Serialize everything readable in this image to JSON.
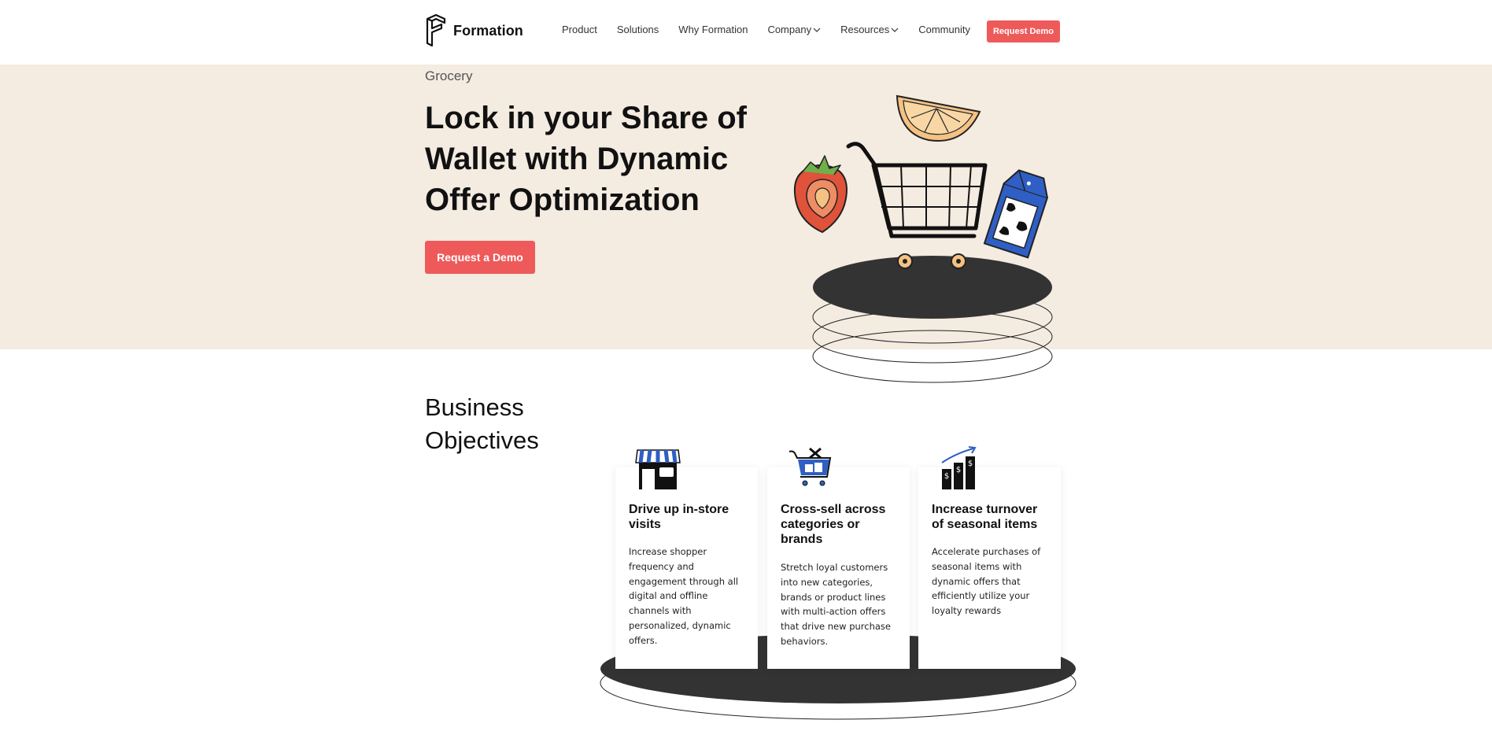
{
  "header": {
    "brand": "Formation",
    "nav": [
      {
        "label": "Product",
        "dropdown": false
      },
      {
        "label": "Solutions",
        "dropdown": false
      },
      {
        "label": "Why Formation",
        "dropdown": false
      },
      {
        "label": "Company",
        "dropdown": true
      },
      {
        "label": "Resources",
        "dropdown": true
      },
      {
        "label": "Community",
        "dropdown": false
      }
    ],
    "cta": "Request Demo"
  },
  "hero": {
    "eyebrow": "Grocery",
    "title": "Lock in your Share of Wallet with Dynamic Offer Optimization",
    "cta": "Request a Demo"
  },
  "objectives": {
    "title": "Business Objectives",
    "cards": [
      {
        "icon": "storefront-icon",
        "heading": "Drive up in-store visits",
        "body": "Increase shopper frequency and engagement through all digital and offline channels with personalized, dynamic offers."
      },
      {
        "icon": "shopping-basket-icon",
        "heading": "Cross-sell across categories or brands",
        "body": "Stretch loyal customers into new categories, brands or product lines with multi-action offers that drive new purchase behaviors."
      },
      {
        "icon": "growth-chart-icon",
        "heading": "Increase turnover of seasonal items",
        "body": "Accelerate purchases of seasonal items with dynamic offers that efficiently utilize your loyalty rewards"
      }
    ]
  },
  "colors": {
    "accent": "#ee5a5a",
    "hero_bg": "#f4ebe1",
    "dark": "#333333",
    "blue": "#2f5fc4"
  }
}
